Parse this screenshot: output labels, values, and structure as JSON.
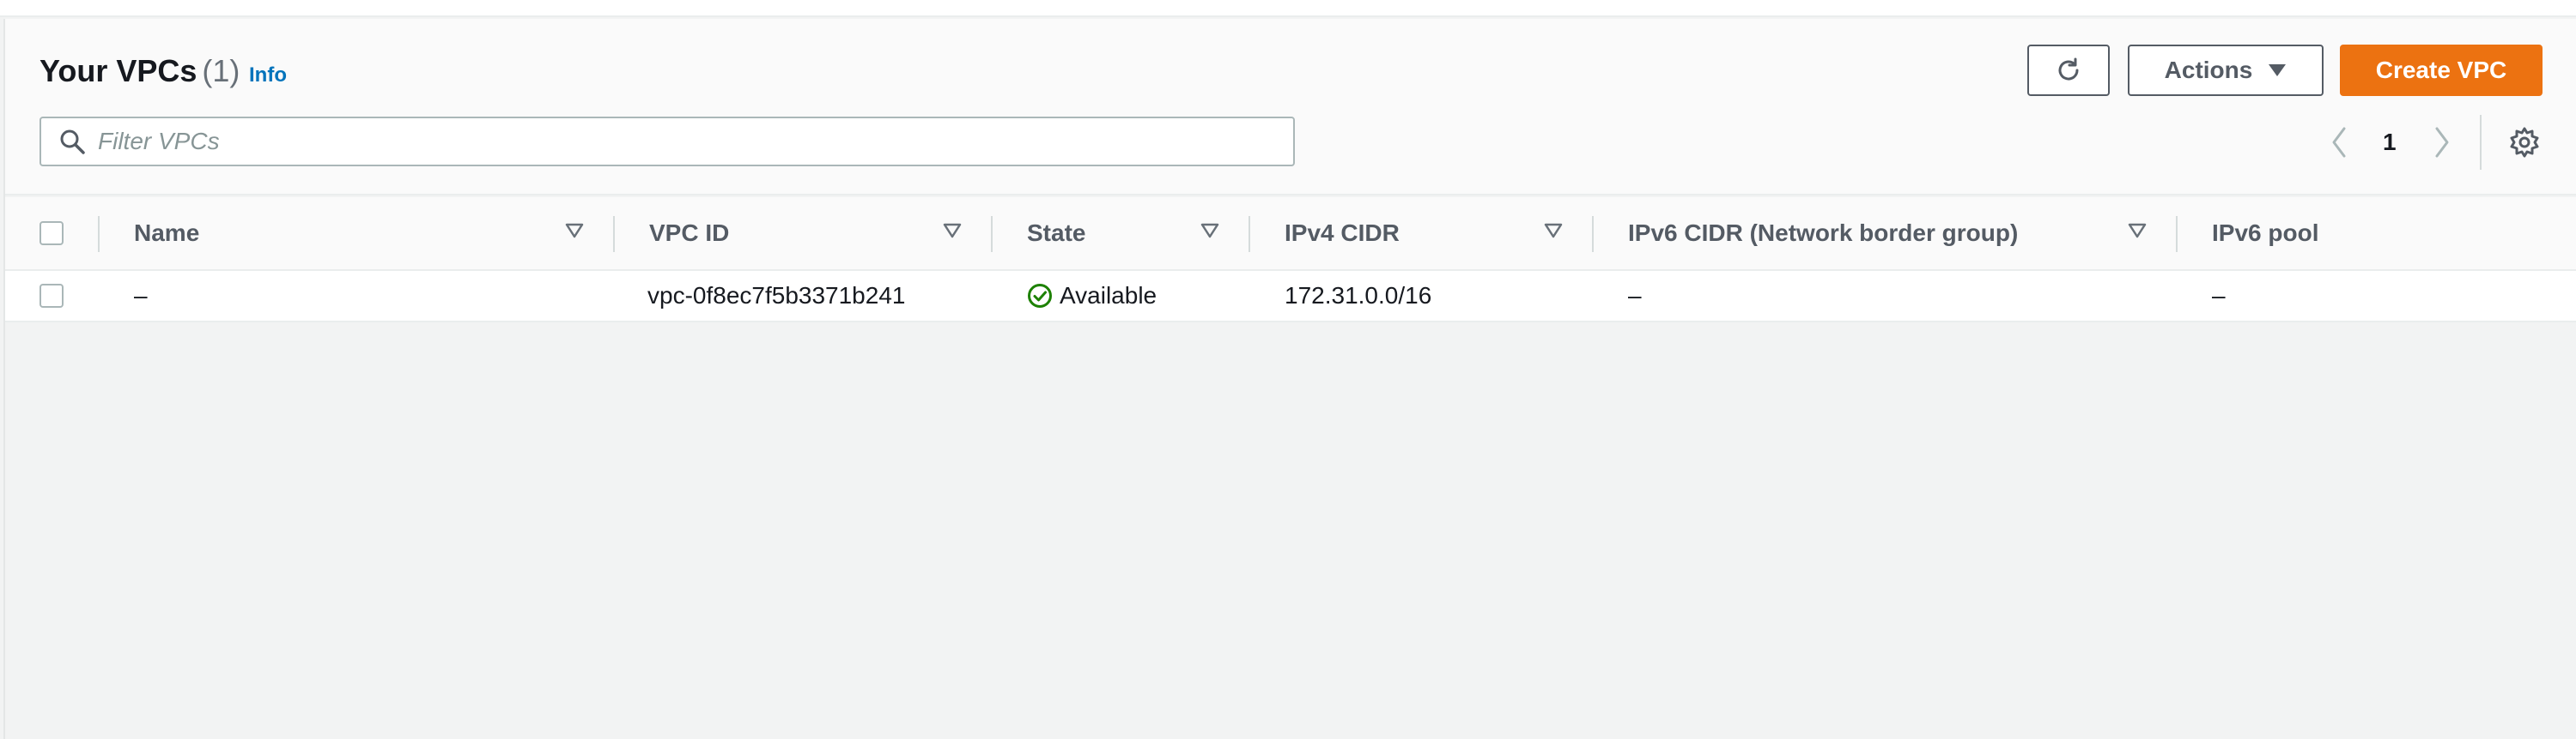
{
  "header": {
    "title": "Your VPCs",
    "count": "(1)",
    "info_label": "Info"
  },
  "toolbar": {
    "actions_label": "Actions",
    "create_label": "Create VPC"
  },
  "filter": {
    "placeholder": "Filter VPCs",
    "value": ""
  },
  "pagination": {
    "current_page": "1"
  },
  "table": {
    "columns": [
      "Name",
      "VPC ID",
      "State",
      "IPv4 CIDR",
      "IPv6 CIDR (Network border group)",
      "IPv6 pool"
    ],
    "rows": [
      {
        "name": "–",
        "vpc_id": "vpc-0f8ec7f5b3371b241",
        "state": "Available",
        "ipv4_cidr": "172.31.0.0/16",
        "ipv6_cidr": "–",
        "ipv6_pool": "–"
      }
    ]
  },
  "colors": {
    "accent_orange": "#ec7211",
    "link_blue": "#0073bb",
    "status_green": "#1d8102"
  },
  "icons": {
    "refresh": "refresh-icon",
    "actions_caret": "caret-down-icon",
    "search": "search-icon",
    "prev": "chevron-left-icon",
    "next": "chevron-right-icon",
    "settings": "gear-icon",
    "sort": "sort-triangle-icon",
    "status": "check-circle-icon"
  }
}
